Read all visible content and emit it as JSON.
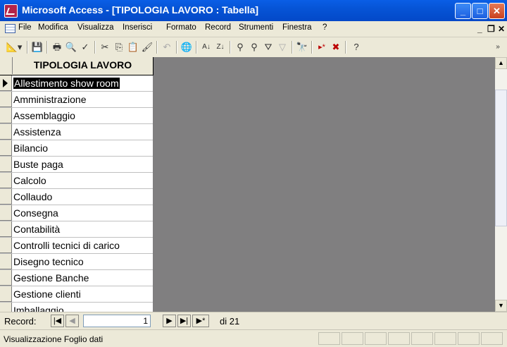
{
  "window": {
    "title": "Microsoft Access - [TIPOLOGIA LAVORO : Tabella]",
    "controls": {
      "minimize": "_",
      "maximize": "□",
      "close": "✕"
    }
  },
  "menubar": {
    "items": [
      "File",
      "Modifica",
      "Visualizza",
      "Inserisci",
      "Formato",
      "Record",
      "Strumenti",
      "Finestra",
      "?"
    ],
    "mdi_controls": {
      "minimize": "_",
      "restore": "❐",
      "close": "✕"
    }
  },
  "toolbar": {
    "icons": [
      "design-view-icon",
      "save-icon",
      "print-icon",
      "print-preview-icon",
      "spelling-icon",
      "cut-icon",
      "copy-icon",
      "paste-icon",
      "format-painter-icon",
      "undo-icon",
      "insert-hyperlink-icon",
      "sort-ascending-icon",
      "sort-descending-icon",
      "filter-by-selection-icon",
      "filter-by-form-icon",
      "apply-filter-icon",
      "remove-filter-icon",
      "find-icon",
      "new-record-icon",
      "delete-record-icon",
      "help-icon",
      "toolbar-options-icon"
    ]
  },
  "datasheet": {
    "column_header": "TIPOLOGIA LAVORO",
    "rows": [
      "Allestimento show room",
      "Amministrazione",
      "Assemblaggio",
      "Assistenza",
      "Bilancio",
      "Buste paga",
      "Calcolo",
      "Collaudo",
      "Consegna",
      "Contabilità",
      "Controlli tecnici di carico",
      "Disegno tecnico",
      "Gestione Banche",
      "Gestione clienti",
      "Imballaggio"
    ],
    "current_row": 0
  },
  "navigation": {
    "label": "Record:",
    "current": "1",
    "total": "di 21"
  },
  "statusbar": {
    "text": "Visualizzazione Foglio dati"
  }
}
